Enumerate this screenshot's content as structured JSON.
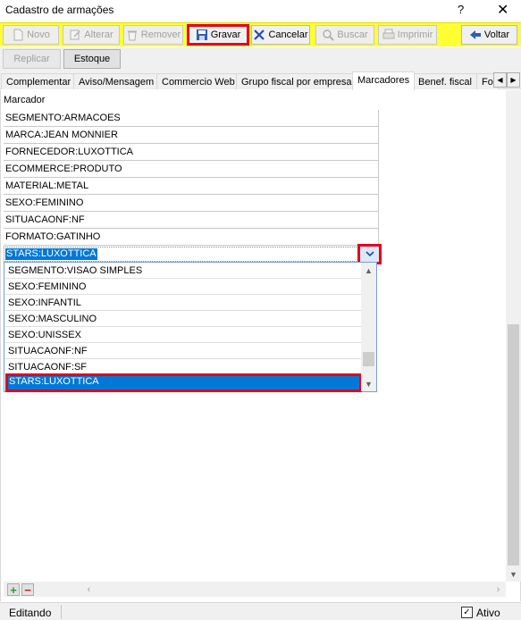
{
  "window": {
    "title": "Cadastro de armações",
    "help": "?",
    "close": "✕"
  },
  "toolbar": {
    "novo": "Novo",
    "alterar": "Alterar",
    "remover": "Remover",
    "gravar": "Gravar",
    "cancelar": "Cancelar",
    "buscar": "Buscar",
    "imprimir": "Imprimir",
    "voltar": "Voltar"
  },
  "subbar": {
    "replicar": "Replicar",
    "estoque": "Estoque"
  },
  "tabs": [
    {
      "label": "Complementar"
    },
    {
      "label": "Aviso/Mensagem"
    },
    {
      "label": "Commercio Web"
    },
    {
      "label": "Grupo fiscal por empresa"
    },
    {
      "label": "Marcadores"
    },
    {
      "label": "Benef. fiscal"
    },
    {
      "label": "Fo"
    }
  ],
  "grid": {
    "column_header": "Marcador",
    "rows": [
      "SEGMENTO:ARMACOES",
      "MARCA:JEAN MONNIER",
      "FORNECEDOR:LUXOTTICA",
      "ECOMMERCE:PRODUTO",
      "MATERIAL:METAL",
      "SEXO:FEMININO",
      "SITUACAONF:NF",
      "FORMATO:GATINHO"
    ],
    "editing_value": "STARS:LUXOTTICA"
  },
  "dropdown": {
    "options": [
      "SEGMENTO:VISAO SIMPLES",
      "SEXO:FEMININO",
      "SEXO:INFANTIL",
      "SEXO:MASCULINO",
      "SEXO:UNISSEX",
      "SITUACAONF:NF",
      "SITUACAONF:SF",
      "STARS:LUXOTTICA"
    ],
    "selected": "STARS:LUXOTTICA"
  },
  "grid_buttons": {
    "add": "+",
    "remove": "−"
  },
  "statusbar": {
    "status": "Editando",
    "ativo_label": "Ativo",
    "ativo_checked": true
  },
  "colors": {
    "toolbar_bg": "#ffff33",
    "highlight": "#e4001b",
    "selection": "#0078d7"
  }
}
